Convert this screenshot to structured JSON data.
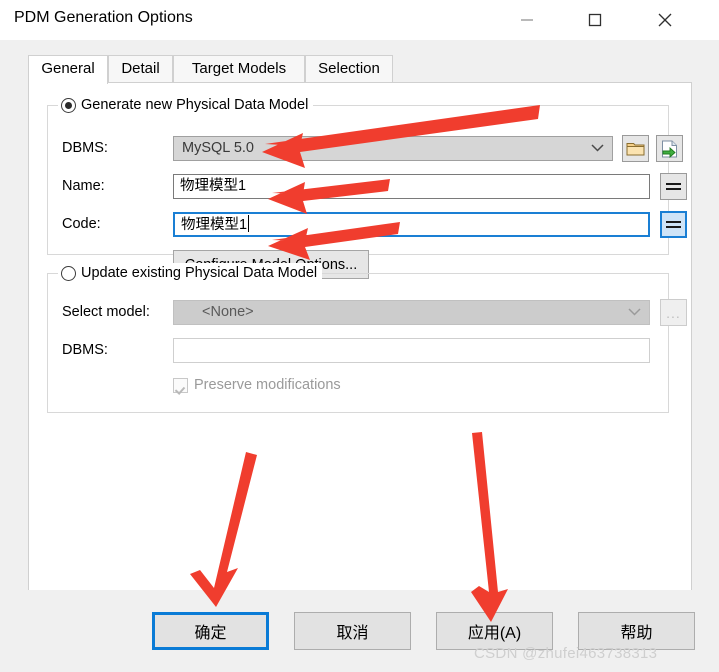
{
  "window": {
    "title": "PDM Generation Options",
    "controls": [
      {
        "name": "minimize",
        "glyph": "minimize-icon"
      },
      {
        "name": "maximize",
        "glyph": "maximize-icon"
      },
      {
        "name": "close",
        "glyph": "close-icon"
      }
    ]
  },
  "tabs": [
    {
      "label": "General",
      "active": true
    },
    {
      "label": "Detail",
      "active": false
    },
    {
      "label": "Target Models",
      "active": false
    },
    {
      "label": "Selection",
      "active": false
    }
  ],
  "generate_group": {
    "legend": "Generate new Physical Data Model",
    "radio_selected": true,
    "dbms": {
      "label": "DBMS:",
      "value": "MySQL 5.0",
      "browse_icon": "folder-icon",
      "import_icon": "import-model-icon"
    },
    "name": {
      "label": "Name:",
      "value": "物理模型1",
      "equals_button": "="
    },
    "code": {
      "label": "Code:",
      "value": "物理模型1",
      "equals_button": "=",
      "focused": true
    },
    "configure_button": "Configure Model Options..."
  },
  "update_group": {
    "legend": "Update existing Physical Data Model",
    "radio_selected": false,
    "select_model": {
      "label": "Select model:",
      "value": "<None>",
      "browse_button": "..."
    },
    "dbms": {
      "label": "DBMS:",
      "value": ""
    },
    "preserve": {
      "label": "Preserve modifications",
      "checked": true,
      "disabled": true
    }
  },
  "buttons": {
    "ok": "确定",
    "cancel": "取消",
    "apply": "应用(A)",
    "help": "帮助"
  },
  "watermark": "CSDN @zhufei463738313",
  "colors": {
    "accent_blue": "#0a7bd6",
    "arrow_red": "#f03d2e",
    "dialog_bg": "#f0f0f0",
    "panel_bg": "#ffffff"
  }
}
